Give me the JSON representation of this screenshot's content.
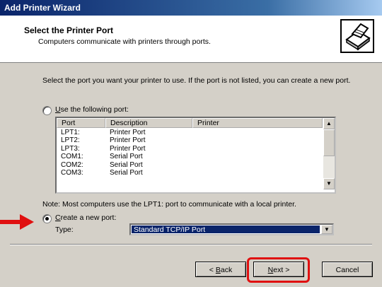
{
  "window": {
    "title": "Add Printer Wizard"
  },
  "header": {
    "title": "Select the Printer Port",
    "subtitle": "Computers communicate with printers through ports.",
    "icon": "printer-icon"
  },
  "instructions": "Select the port you want your printer to use.  If the port is not listed, you can create a new port.",
  "use_port_option": {
    "label_prefix": "",
    "accel": "U",
    "label_rest": "se the following port:",
    "selected": false
  },
  "port_list": {
    "columns": [
      "Port",
      "Description",
      "Printer"
    ],
    "rows": [
      {
        "port": "LPT1:",
        "description": "Printer Port"
      },
      {
        "port": "LPT2:",
        "description": "Printer Port"
      },
      {
        "port": "LPT3:",
        "description": "Printer Port"
      },
      {
        "port": "COM1:",
        "description": "Serial Port"
      },
      {
        "port": "COM2:",
        "description": "Serial Port"
      },
      {
        "port": "COM3:",
        "description": "Serial Port"
      }
    ]
  },
  "note": "Note: Most computers use the LPT1: port to communicate with a local printer.",
  "create_port_option": {
    "accel": "C",
    "label_rest": "reate a new port:",
    "selected": true
  },
  "type_field": {
    "label": "Type:",
    "value": "Standard TCP/IP Port"
  },
  "buttons": {
    "back": {
      "prefix": "< ",
      "accel": "B",
      "rest": "ack"
    },
    "next": {
      "accel": "N",
      "rest": "ext >"
    },
    "cancel": "Cancel"
  },
  "annotation_color": "#e01010"
}
